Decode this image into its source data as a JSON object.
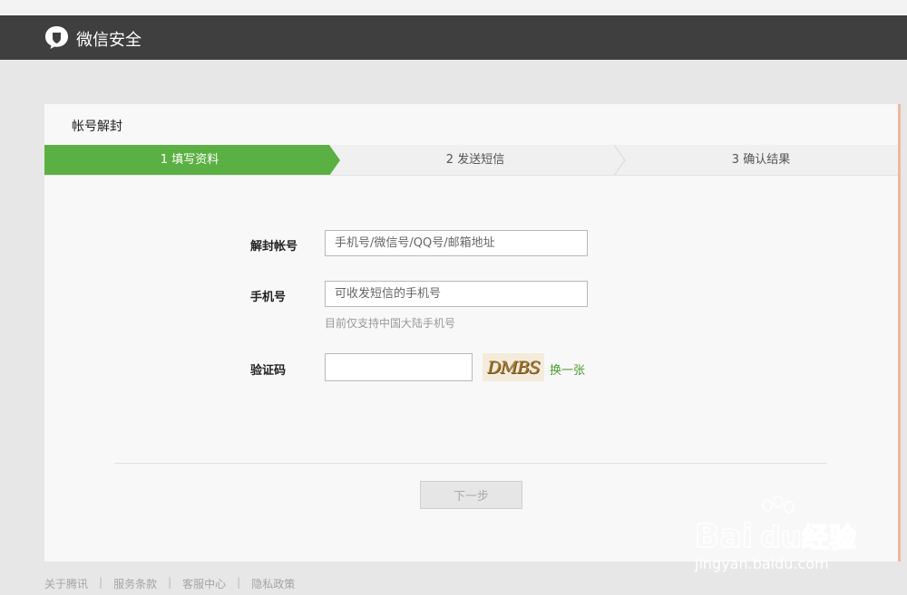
{
  "header": {
    "title": "微信安全"
  },
  "card": {
    "title": "帐号解封"
  },
  "steps": [
    "1 填写资料",
    "2 发送短信",
    "3 确认结果"
  ],
  "form": {
    "account": {
      "label": "解封帐号",
      "placeholder": "手机号/微信号/QQ号/邮箱地址"
    },
    "phone": {
      "label": "手机号",
      "placeholder": "可收发短信的手机号",
      "hint": "目前仅支持中国大陆手机号"
    },
    "captcha": {
      "label": "验证码",
      "value": "",
      "image_text": "DMBS",
      "refresh_label": "换一张"
    }
  },
  "next_button": "下一步",
  "footer": [
    "关于腾讯",
    "服务条款",
    "客服中心",
    "隐私政策"
  ],
  "watermark": {
    "brand_left": "Bai",
    "brand_mid": "du",
    "brand_cn": "经验",
    "url": "jingyan.baidu.com"
  },
  "colors": {
    "header_bg": "#3f3f3f",
    "active_step": "#5bb043",
    "link": "#4b9a2f"
  }
}
